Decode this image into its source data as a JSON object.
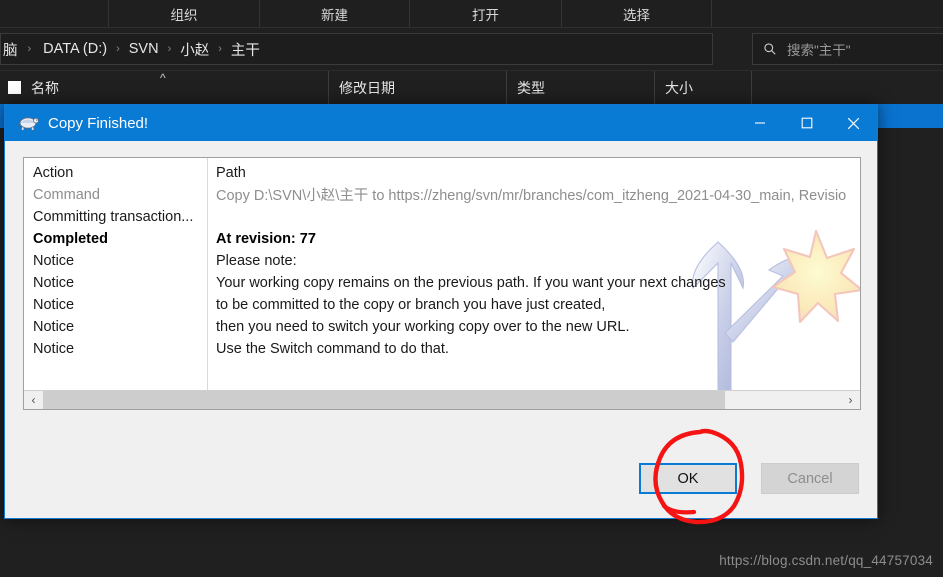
{
  "explorer": {
    "toolbar": [
      {
        "label": "组织",
        "icon": "organize-icon"
      },
      {
        "label": "新建",
        "icon": "new-icon"
      },
      {
        "label": "打开",
        "icon": "open-icon"
      },
      {
        "label": "选择",
        "icon": "select-icon"
      }
    ],
    "breadcrumb": {
      "items": [
        "脑",
        "DATA (D:)",
        "SVN",
        "小赵",
        "主干"
      ],
      "separator": "›",
      "dropdown_icon": "chevron-down-icon",
      "refresh_icon": "refresh-icon"
    },
    "search": {
      "placeholder": "搜索\"主干\"",
      "icon": "search-icon"
    },
    "columns": [
      {
        "label": "名称",
        "sort": "^"
      },
      {
        "label": "修改日期"
      },
      {
        "label": "类型"
      },
      {
        "label": "大小"
      }
    ]
  },
  "dialog": {
    "title": "Copy Finished!",
    "icon": "tortoise-svn-turtle-icon",
    "window_buttons": {
      "minimize": "minimize-icon",
      "maximize": "maximize-icon",
      "close": "close-icon"
    },
    "log": {
      "headers": {
        "action": "Action",
        "path": "Path"
      },
      "rows": [
        {
          "action": "Command",
          "path": "Copy D:\\SVN\\小赵\\主干 to https://zheng/svn/mr/branches/com_itzheng_2021-04-30_main, Revisio",
          "style": "gray"
        },
        {
          "action": "Committing transaction...",
          "path": "",
          "style": "normal"
        },
        {
          "action": "Completed",
          "path": "At revision: 77",
          "style": "bold"
        },
        {
          "action": "Notice",
          "path": "Please note:",
          "style": "normal"
        },
        {
          "action": "Notice",
          "path": "Your working copy remains on the previous path. If you want your next changes",
          "style": "normal"
        },
        {
          "action": "Notice",
          "path": "to be committed to the copy or branch you have just created,",
          "style": "normal"
        },
        {
          "action": "Notice",
          "path": "then you need to switch your working copy over to the new URL.",
          "style": "normal"
        },
        {
          "action": "Notice",
          "path": "Use the Switch command to do that.",
          "style": "normal"
        }
      ],
      "scrollbar": {
        "left_arrow": "‹",
        "right_arrow": "›"
      }
    },
    "buttons": {
      "ok": "OK",
      "cancel": "Cancel"
    },
    "graphic": "branch-arrow-star-icon"
  },
  "annotation": {
    "shape": "hand-drawn-red-circle",
    "color": "#f41414",
    "targets": "ok-button"
  },
  "watermark": "https://blog.csdn.net/qq_44757034",
  "colors": {
    "accent_blue": "#0a7bd4",
    "explorer_bg": "#202020",
    "dialog_bg": "#f0f0f0",
    "selection_blue": "#0a73d0",
    "annotation_red": "#f41414"
  }
}
